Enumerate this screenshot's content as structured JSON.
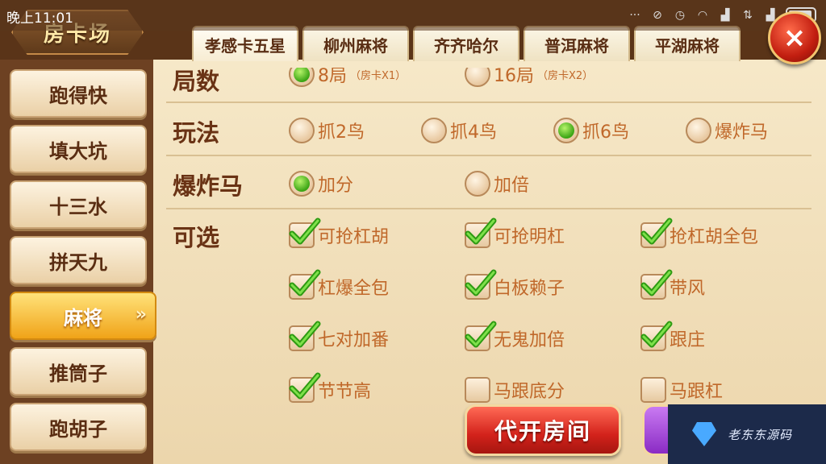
{
  "status_bar": {
    "time": "晚上11:01"
  },
  "header": {
    "title": "房卡场"
  },
  "tabs": [
    {
      "label": "孝感卡五星"
    },
    {
      "label": "柳州麻将"
    },
    {
      "label": "齐齐哈尔"
    },
    {
      "label": "普洱麻将"
    },
    {
      "label": "平湖麻将"
    }
  ],
  "sidebar": {
    "items": [
      {
        "label": "跑得快"
      },
      {
        "label": "填大坑"
      },
      {
        "label": "十三水"
      },
      {
        "label": "拼天九"
      },
      {
        "label": "麻将",
        "active": true
      },
      {
        "label": "推筒子"
      },
      {
        "label": "跑胡子"
      }
    ]
  },
  "settings": {
    "rounds": {
      "label": "局数",
      "options": [
        {
          "label": "8局",
          "sub": "（房卡X1）",
          "selected": true
        },
        {
          "label": "16局",
          "sub": "（房卡X2）",
          "selected": false
        }
      ]
    },
    "play_mode": {
      "label": "玩法",
      "options": [
        {
          "label": "抓2鸟",
          "selected": false
        },
        {
          "label": "抓4鸟",
          "selected": false
        },
        {
          "label": "抓6鸟",
          "selected": true
        },
        {
          "label": "爆炸马",
          "selected": false
        }
      ]
    },
    "bomb_horse": {
      "label": "爆炸马",
      "options": [
        {
          "label": "加分",
          "selected": true
        },
        {
          "label": "加倍",
          "selected": false
        }
      ]
    },
    "optional": {
      "label": "可选",
      "options": [
        {
          "label": "可抢杠胡",
          "checked": true
        },
        {
          "label": "可抢明杠",
          "checked": true
        },
        {
          "label": "抢杠胡全包",
          "checked": true
        },
        {
          "label": "杠爆全包",
          "checked": true
        },
        {
          "label": "白板赖子",
          "checked": true
        },
        {
          "label": "带风",
          "checked": true
        },
        {
          "label": "七对加番",
          "checked": true
        },
        {
          "label": "无鬼加倍",
          "checked": true
        },
        {
          "label": "跟庄",
          "checked": true
        },
        {
          "label": "节节高",
          "checked": true
        },
        {
          "label": "马跟底分",
          "checked": false
        },
        {
          "label": "马跟杠",
          "checked": false
        }
      ]
    }
  },
  "buttons": {
    "create_room": "代开房间",
    "close": "×"
  },
  "watermark": {
    "text": "老东东源码"
  },
  "colors": {
    "accent_red": "#d3221b",
    "selected_green": "#3aa414",
    "label_brown": "#6a3315",
    "option_orange": "#c0682a"
  }
}
